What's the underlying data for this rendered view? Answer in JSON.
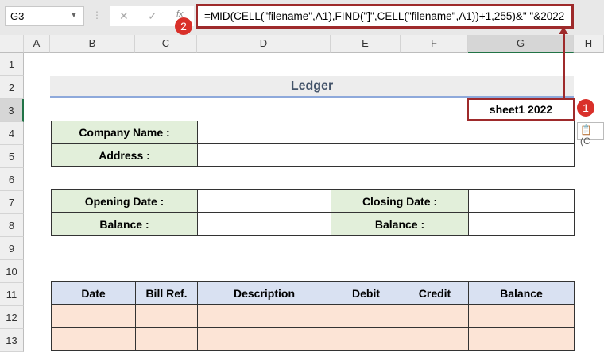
{
  "formula_bar": {
    "name_box": "G3",
    "cancel": "✕",
    "enter": "✓",
    "fx": "fx",
    "formula": "=MID(CELL(\"filename\",A1),FIND(\"]\",CELL(\"filename\",A1))+1,255)&\" \"&2022"
  },
  "annotations": {
    "badge1": "1",
    "badge2": "2"
  },
  "columns": [
    "A",
    "B",
    "C",
    "D",
    "E",
    "F",
    "G",
    "H"
  ],
  "rows": [
    "1",
    "2",
    "3",
    "4",
    "5",
    "6",
    "7",
    "8",
    "9",
    "10",
    "11",
    "12",
    "13"
  ],
  "sheet": {
    "title": "Ledger",
    "g3": "sheet1 2022",
    "company_label": "Company Name :",
    "address_label": "Address :",
    "opening_label": "Opening Date :",
    "balance_label": "Balance :",
    "closing_label": "Closing Date :",
    "balance_label2": "Balance :",
    "headers": [
      "Date",
      "Bill Ref.",
      "Description",
      "Debit",
      "Credit",
      "Balance"
    ],
    "paste_hint": "(C"
  }
}
